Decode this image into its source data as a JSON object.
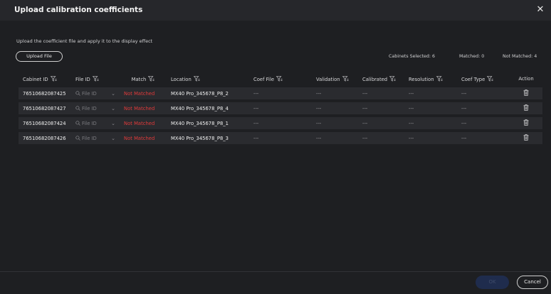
{
  "dialog": {
    "title": "Upload calibration coefficients",
    "close_icon": "close-icon",
    "subtitle": "Upload the coefficient file and apply it to the display effect",
    "upload_label": "Upload File",
    "stats": {
      "selected": "Cabinets Selected: 6",
      "matched": "Matched: 0",
      "not_matched": "Not Matched: 4"
    }
  },
  "table": {
    "headers": {
      "cabinet_id": "Cabinet ID",
      "file_id": "File ID",
      "match": "Match",
      "location": "Location",
      "coef_file": "Coef File",
      "validation": "Validation",
      "calibrated": "Calibrated",
      "resolution": "Resolution",
      "coef_type": "Coef Type",
      "action": "Action"
    },
    "file_placeholder": "File ID",
    "rows": [
      {
        "cabinet_id": "76510682087425",
        "match": "Not Matched",
        "location": "MX40 Pro_345678_P8_2",
        "coef_file": "---",
        "validation": "---",
        "calibrated": "---",
        "resolution": "---",
        "coef_type": "---"
      },
      {
        "cabinet_id": "76510682087427",
        "match": "Not Matched",
        "location": "MX40 Pro_345678_P8_4",
        "coef_file": "---",
        "validation": "---",
        "calibrated": "---",
        "resolution": "---",
        "coef_type": "---"
      },
      {
        "cabinet_id": "76510682087424",
        "match": "Not Matched",
        "location": "MX40 Pro_345678_P8_1",
        "coef_file": "---",
        "validation": "---",
        "calibrated": "---",
        "resolution": "---",
        "coef_type": "---"
      },
      {
        "cabinet_id": "76510682087426",
        "match": "Not Matched",
        "location": "MX40 Pro_345678_P8_3",
        "coef_file": "---",
        "validation": "---",
        "calibrated": "---",
        "resolution": "---",
        "coef_type": "---"
      }
    ]
  },
  "footer": {
    "ok_label": "OK",
    "cancel_label": "Cancel"
  },
  "colors": {
    "background": "#1e1f22",
    "row": "#2a2b2f",
    "not_matched": "#e23a3a",
    "ok_disabled": "#1f2c4d"
  },
  "icons": [
    "filter-icon",
    "search-icon",
    "chevron-down-icon",
    "trash-icon",
    "close-icon"
  ]
}
